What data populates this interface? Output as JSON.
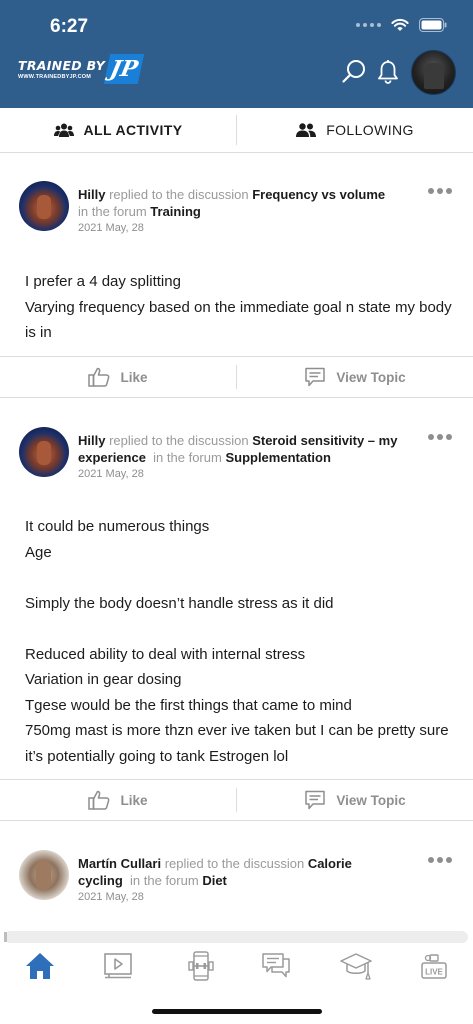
{
  "status_bar": {
    "time": "6:27"
  },
  "header": {
    "logo_text": "TRAINED BY",
    "logo_url": "WWW.TRAINEDBYJP.COM",
    "logo_badge": "JP",
    "icons": [
      "search-icon",
      "bell-icon"
    ],
    "colors": {
      "header_bg": "#2f5d8c",
      "logo_badge": "#1a7fd6"
    }
  },
  "tabs": [
    {
      "label": "ALL ACTIVITY",
      "icon": "group-icon",
      "active": true
    },
    {
      "label": "FOLLOWING",
      "icon": "users-icon",
      "active": false
    }
  ],
  "posts": [
    {
      "user": "Hilly",
      "action": "replied to the discussion",
      "topic": "Frequency vs volume",
      "forum_prefix": "in the forum",
      "forum": "Training",
      "date": "2021 May, 28",
      "body": [
        "I prefer a 4 day splitting",
        "Varying frequency based on the immediate goal n state my body is in"
      ],
      "like_label": "Like",
      "view_label": "View Topic"
    },
    {
      "user": "Hilly",
      "action": "replied to the discussion",
      "topic": "Steroid sensitivity – my experience",
      "forum_prefix": "in the forum",
      "forum": "Supplementation",
      "date": "2021 May, 28",
      "body": [
        "It could be numerous things",
        "Age",
        "",
        "Simply the body doesn’t handle stress as it did",
        "",
        "Reduced ability to deal with internal stress",
        "Variation in gear dosing",
        "Tgese would be the first things that came to mind",
        "750mg mast is more thzn ever ive taken but I can be pretty sure it’s potentially going to tank Estrogen lol"
      ],
      "like_label": "Like",
      "view_label": "View Topic"
    },
    {
      "user": "Martín Cullari",
      "action": "replied to the discussion",
      "topic": "Calorie cycling",
      "forum_prefix": "in the forum",
      "forum": "Diet",
      "date": "2021 May, 28"
    }
  ],
  "bottom_nav": [
    {
      "icon": "home-icon",
      "active": true
    },
    {
      "icon": "video-icon",
      "active": false
    },
    {
      "icon": "workout-phone-icon",
      "active": false
    },
    {
      "icon": "forums-icon",
      "active": false
    },
    {
      "icon": "courses-icon",
      "active": false
    },
    {
      "icon": "live-icon",
      "label": "LIVE",
      "active": false
    }
  ]
}
